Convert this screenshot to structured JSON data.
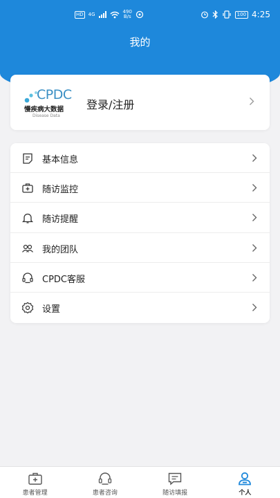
{
  "status_bar": {
    "hd_label": "HD",
    "network_label": "4G",
    "speed_value": "490",
    "speed_unit": "B/s",
    "battery": "100",
    "time": "4:25"
  },
  "header": {
    "title": "我的"
  },
  "login": {
    "logo_text": "CPDC",
    "logo_cn": "慢疾病大数据",
    "logo_en": "Disease Data",
    "label": "登录/注册"
  },
  "menu": {
    "items": [
      {
        "label": "基本信息",
        "icon": "profile-icon"
      },
      {
        "label": "随访监控",
        "icon": "medical-kit-icon"
      },
      {
        "label": "随访提醒",
        "icon": "bell-icon"
      },
      {
        "label": "我的团队",
        "icon": "team-icon"
      },
      {
        "label": "CPDC客服",
        "icon": "headset-icon"
      },
      {
        "label": "设置",
        "icon": "gear-icon"
      }
    ]
  },
  "tabbar": {
    "items": [
      {
        "label": "患者管理",
        "icon": "medical-kit-icon"
      },
      {
        "label": "患者咨询",
        "icon": "headset-icon"
      },
      {
        "label": "随访填报",
        "icon": "chat-icon"
      },
      {
        "label": "个人",
        "icon": "user-icon"
      }
    ],
    "active_index": 3
  },
  "colors": {
    "accent": "#1e88db",
    "background": "#f2f2f4",
    "card": "#ffffff"
  }
}
